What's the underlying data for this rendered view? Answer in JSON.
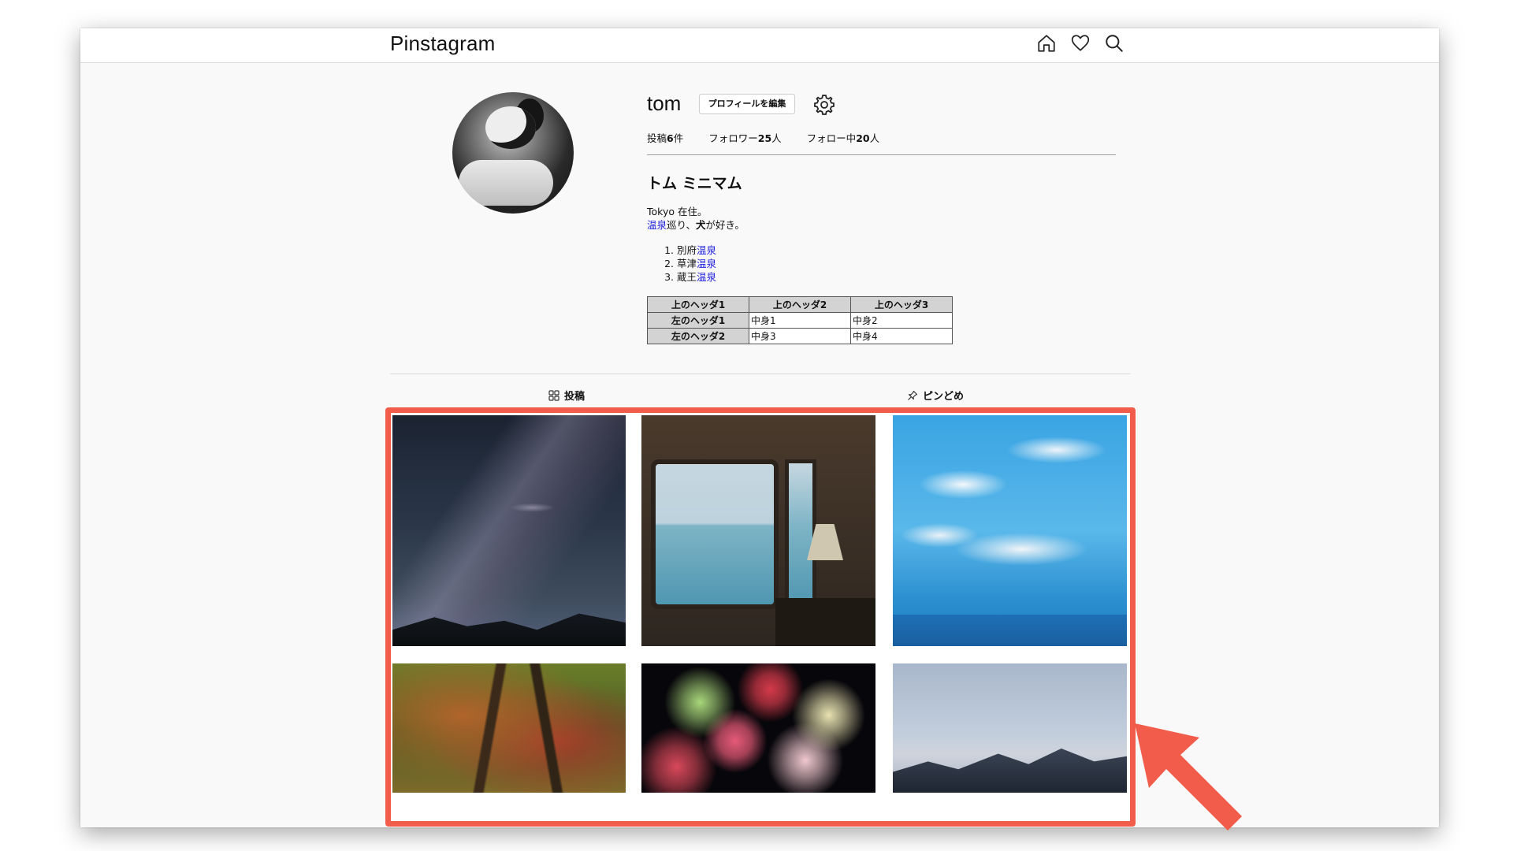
{
  "app": {
    "title": "Pinstagram"
  },
  "nav": {
    "icons": [
      "home-icon",
      "heart-icon",
      "search-icon"
    ]
  },
  "profile": {
    "username": "tom",
    "edit_button_label": "プロフィールを編集",
    "stats": {
      "posts_label": "投稿",
      "posts_count": "6",
      "posts_unit": "件",
      "followers_label": "フォロワー",
      "followers_count": "25",
      "followers_unit": "人",
      "following_label": "フォロー中",
      "following_count": "20",
      "following_unit": "人"
    },
    "full_name": "トム ミニマム",
    "bio": {
      "line1": "Tokyo 在住。",
      "line2_link": "温泉",
      "line2_mid": "巡り、",
      "line2_bold": "犬",
      "line2_rest": "が好き。"
    },
    "list": [
      {
        "prefix": "別府",
        "link": "温泉"
      },
      {
        "prefix": "草津",
        "link": "温泉"
      },
      {
        "prefix": "蔵王",
        "link": "温泉"
      }
    ],
    "table": {
      "headers": [
        "上のヘッダ1",
        "上のヘッダ2",
        "上のヘッダ3"
      ],
      "rows": [
        {
          "header": "左のヘッダ1",
          "cells": [
            "中身1",
            "中身2"
          ]
        },
        {
          "header": "左のヘッダ2",
          "cells": [
            "中身3",
            "中身4"
          ]
        }
      ]
    }
  },
  "tabs": {
    "posts": "投稿",
    "pins": "ピンどめ"
  },
  "posts": [
    {
      "name": "milky-way-night"
    },
    {
      "name": "train-window-sea"
    },
    {
      "name": "blue-sky-clouds"
    },
    {
      "name": "autumn-forest-path"
    },
    {
      "name": "fireworks"
    },
    {
      "name": "mountain-dusk"
    }
  ],
  "annotation": {
    "highlight_color": "#f25c4a"
  }
}
